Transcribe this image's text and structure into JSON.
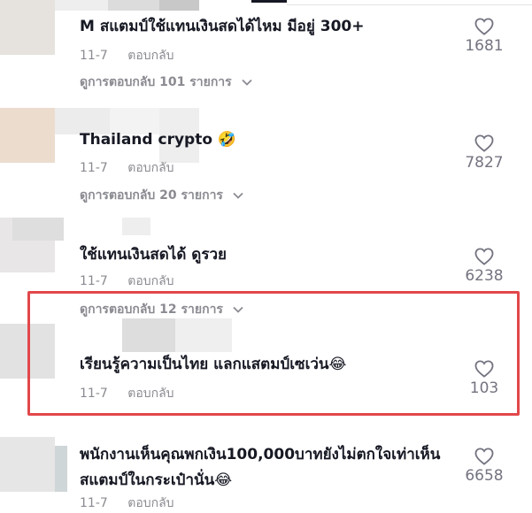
{
  "colors": {
    "highlight": "#e2474b",
    "text": "#161823",
    "muted": "#8a8b91"
  },
  "comments": [
    {
      "text_lines": [
        "M สแตมป์ใช้แทนเงินสดได้ไหม มีอยู่ 300+"
      ],
      "date": "11-7",
      "reply_label": "ตอบกลับ",
      "replies_label": "ดูการตอบกลับ 101 รายการ",
      "likes": "1681"
    },
    {
      "text_lines": [
        "Thailand crypto 🤣"
      ],
      "date": "11-7",
      "reply_label": "ตอบกลับ",
      "replies_label": "ดูการตอบกลับ 20 รายการ",
      "likes": "7827"
    },
    {
      "text_lines": [
        "ใช้แทนเงินสดได้ ดูรวย"
      ],
      "date": "11-7",
      "reply_label": "ตอบกลับ",
      "replies_label": "ดูการตอบกลับ 12 รายการ",
      "likes": "6238"
    },
    {
      "text_lines": [
        "เรียนรู้ความเป็นไทย แลกแสตมป์เซเว่น😂"
      ],
      "date": "11-7",
      "reply_label": "ตอบกลับ",
      "replies_label": "",
      "likes": "103"
    },
    {
      "text_lines": [
        "พนักงานเห็นคุณพกเงิน100,000บาทยังไม่ตกใจเท่าเห็น",
        "สแตมป์ในกระเป๋านั่น😂"
      ],
      "date": "11-7",
      "reply_label": "ตอบกลับ",
      "replies_label": "",
      "likes": "6658"
    }
  ]
}
